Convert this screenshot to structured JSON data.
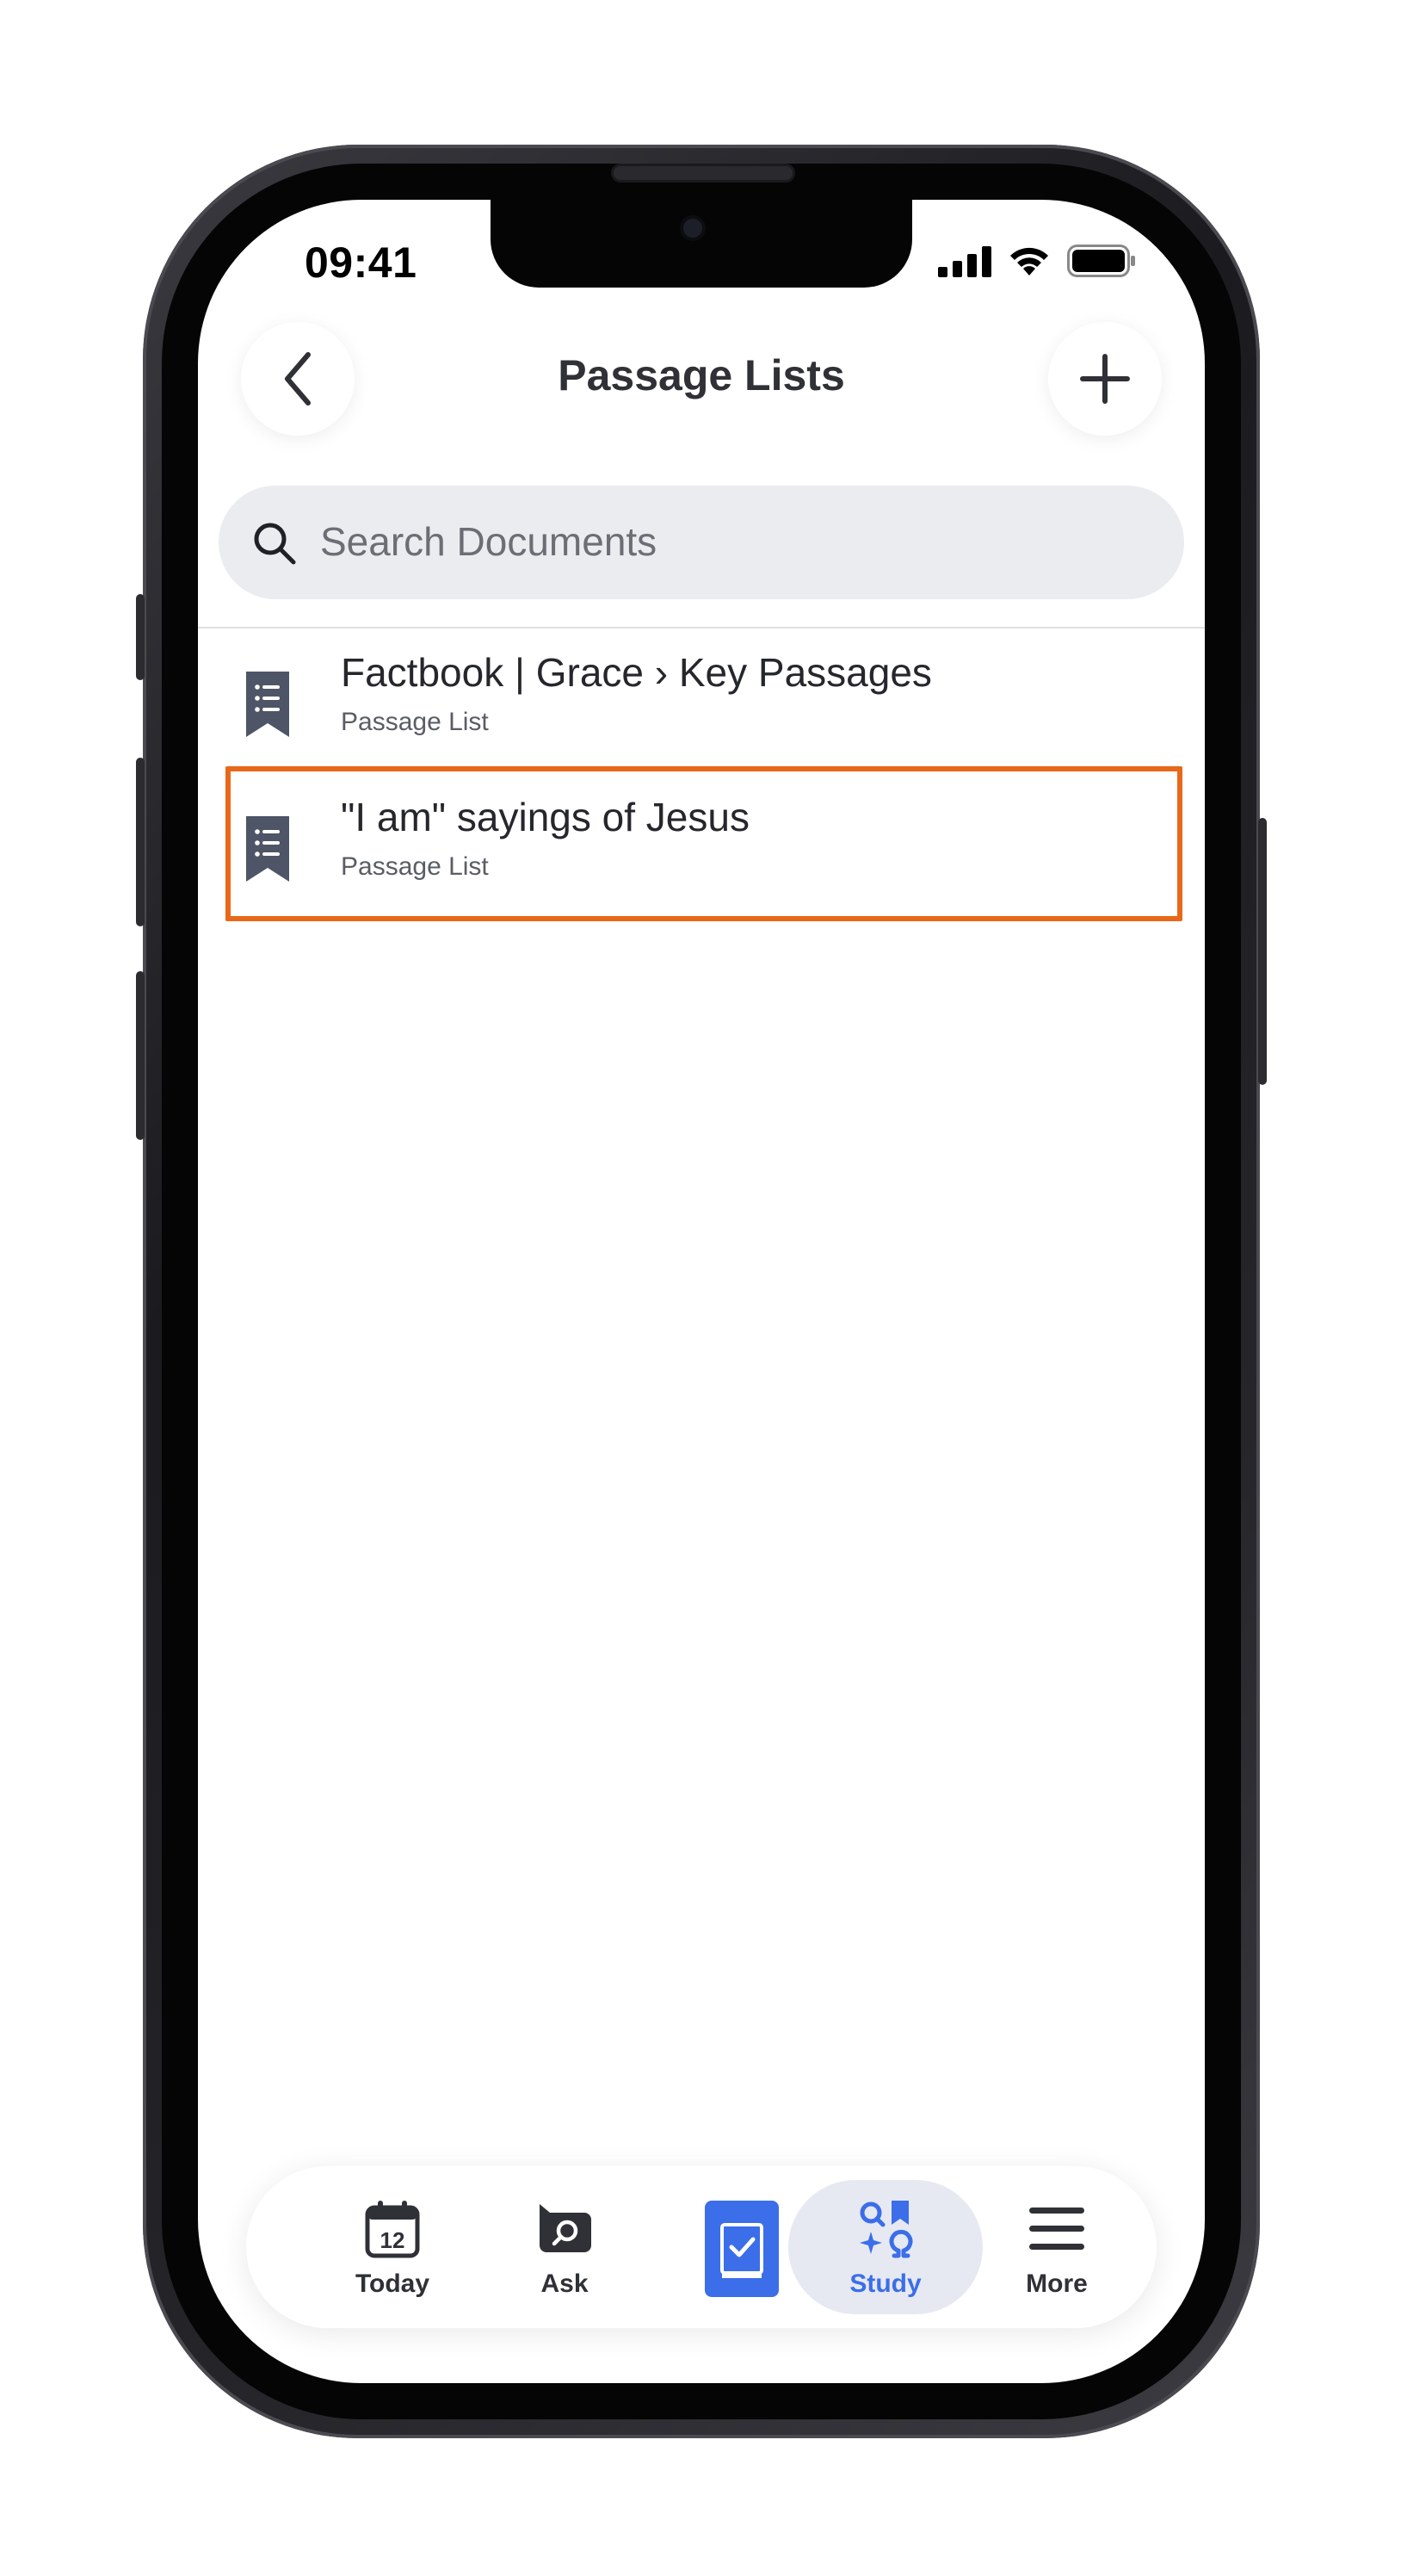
{
  "status_bar": {
    "time": "09:41"
  },
  "header": {
    "title": "Passage Lists",
    "back_icon": "chevron-left-icon",
    "add_icon": "plus-icon"
  },
  "search": {
    "placeholder": "Search Documents"
  },
  "documents": [
    {
      "title": "Factbook | Grace › Key Passages",
      "subtitle": "Passage List",
      "icon": "bookmark-list-icon"
    },
    {
      "title": "\"I am\" sayings of Jesus",
      "subtitle": "Passage List",
      "icon": "bookmark-list-icon",
      "highlighted": true
    }
  ],
  "tab_bar": {
    "today": {
      "label": "Today",
      "icon": "calendar-icon",
      "day": "12"
    },
    "ask": {
      "label": "Ask",
      "icon": "chat-search-icon"
    },
    "bible": {
      "label": "",
      "icon": "book-check-icon"
    },
    "study": {
      "label": "Study",
      "icon": "study-tools-icon",
      "active": true
    },
    "more": {
      "label": "More",
      "icon": "hamburger-menu-icon"
    }
  },
  "colors": {
    "accent": "#3b6ee8",
    "highlight": "#e8681a",
    "search_bg": "#ebecf0",
    "doc_icon": "#4e5566"
  }
}
